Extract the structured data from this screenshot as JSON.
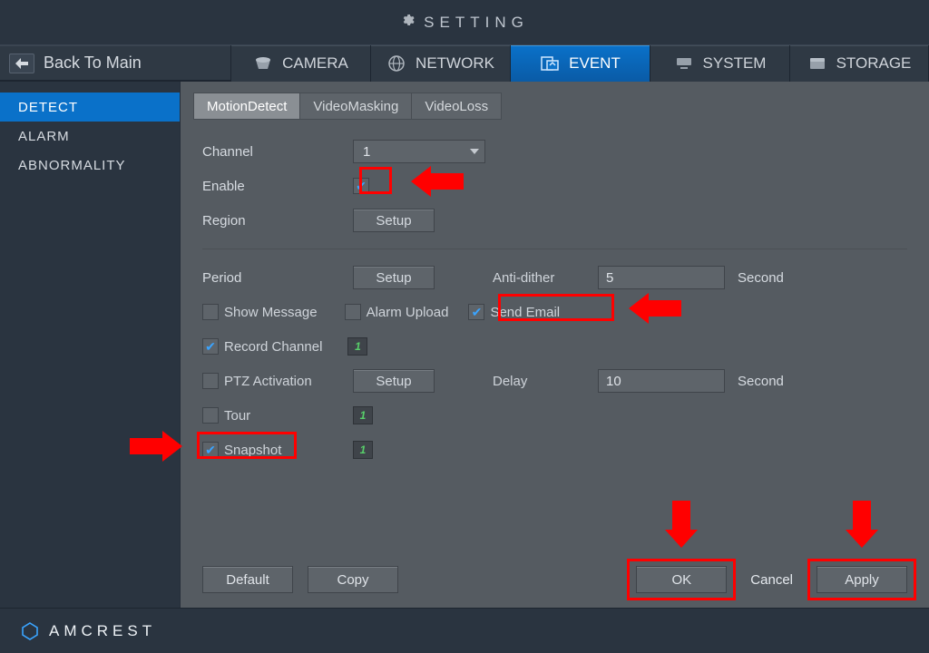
{
  "header": {
    "title": "SETTING"
  },
  "back_label": "Back To Main",
  "nav_tabs": [
    {
      "label": "CAMERA"
    },
    {
      "label": "NETWORK"
    },
    {
      "label": "EVENT"
    },
    {
      "label": "SYSTEM"
    },
    {
      "label": "STORAGE"
    }
  ],
  "sidebar": {
    "items": [
      {
        "label": "DETECT"
      },
      {
        "label": "ALARM"
      },
      {
        "label": "ABNORMALITY"
      }
    ]
  },
  "subtabs": [
    {
      "label": "MotionDetect"
    },
    {
      "label": "VideoMasking"
    },
    {
      "label": "VideoLoss"
    }
  ],
  "form": {
    "channel_label": "Channel",
    "channel_value": "1",
    "enable_label": "Enable",
    "region_label": "Region",
    "setup_btn": "Setup",
    "period_label": "Period",
    "anti_dither_label": "Anti-dither",
    "anti_dither_value": "5",
    "second_label": "Second",
    "show_message": "Show Message",
    "alarm_upload": "Alarm Upload",
    "send_email": "Send Email",
    "record_channel": "Record Channel",
    "ptz_activation": "PTZ Activation",
    "delay_label": "Delay",
    "delay_value": "10",
    "tour": "Tour",
    "snapshot": "Snapshot",
    "tiny_btn_number": "1"
  },
  "footer": {
    "default": "Default",
    "copy": "Copy",
    "ok": "OK",
    "cancel": "Cancel",
    "apply": "Apply"
  },
  "brand": "AMCREST"
}
